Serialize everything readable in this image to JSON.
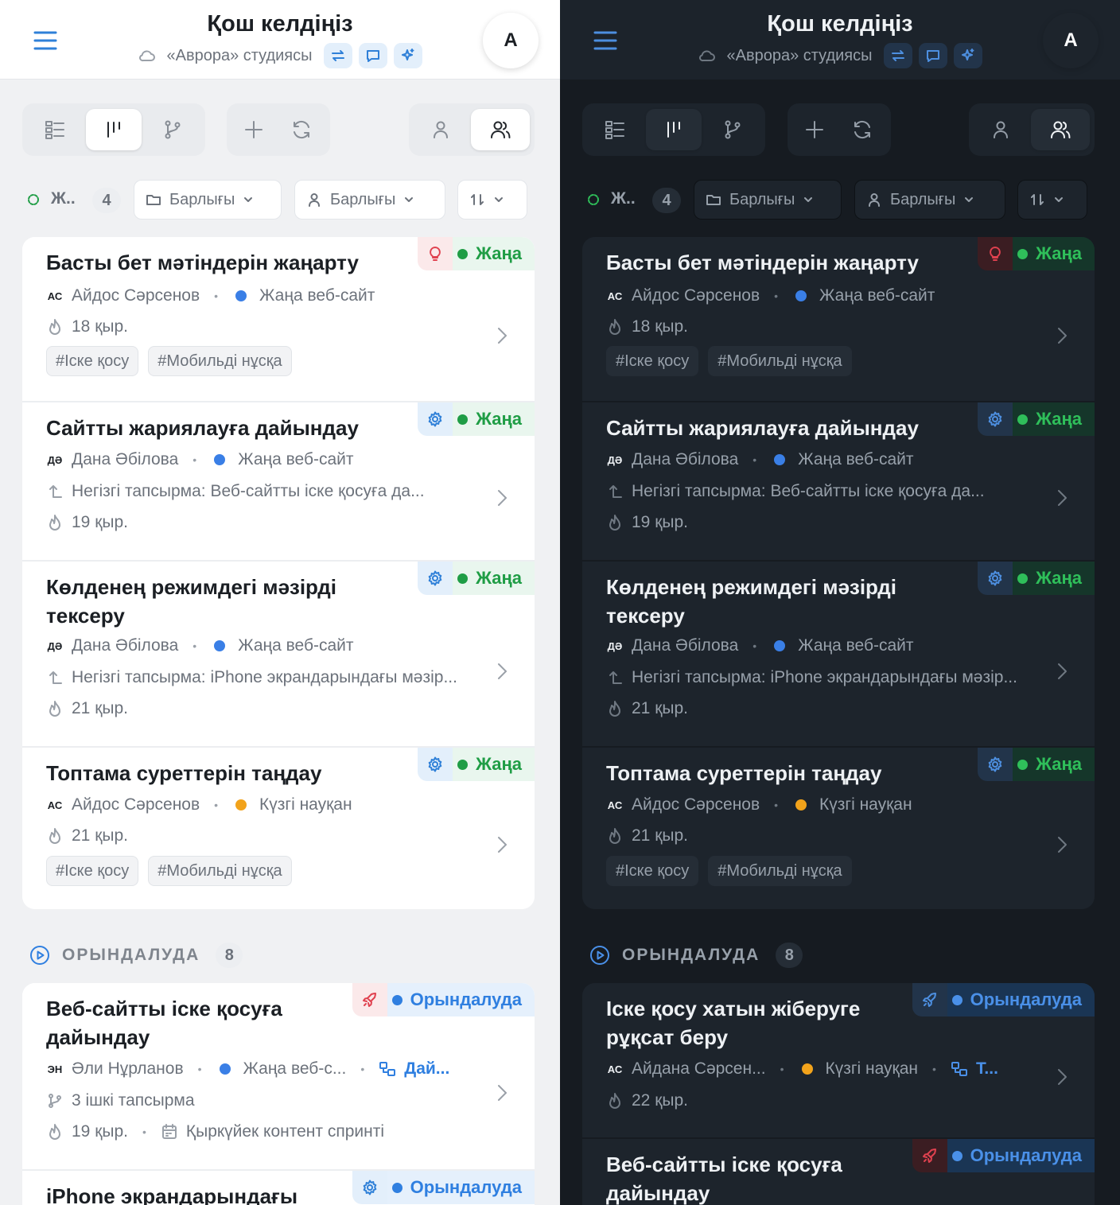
{
  "header": {
    "title": "Қош келдіңіз",
    "workspace": "«Аврора» студиясы",
    "avatar_initial": "A"
  },
  "filters": {
    "status_label": "Ж..",
    "status_count": "4",
    "project_filter": "Барлығы",
    "assignee_filter": "Барлығы"
  },
  "sections": [
    {
      "title": "ОРЫНДАЛУДА",
      "count": "8"
    }
  ],
  "light": {
    "new_tasks": [
      {
        "title": "Басты бет мәтіндерін жаңарту",
        "status": "Жаңа",
        "type_icon": "lightbulb-icon",
        "initials": "АС",
        "assignee": "Айдос Сәрсенов",
        "project": "Жаңа веб-сайт",
        "project_color": "#3a7fe6",
        "due": "18 қыр.",
        "tags": [
          "#Іске қосу",
          "#Мобильді нұсқа"
        ]
      },
      {
        "title": "Сайтты жариялауға дайындау",
        "status": "Жаңа",
        "type_icon": "gear-icon",
        "initials": "ДӘ",
        "assignee": "Дана Әбілова",
        "project": "Жаңа веб-сайт",
        "project_color": "#3a7fe6",
        "parent": "Негізгі тапсырма: Веб-сайтты іске қосуға да...",
        "due": "19 қыр."
      },
      {
        "title": "Көлденең режимдегі мәзірді тексеру",
        "status": "Жаңа",
        "type_icon": "gear-icon",
        "initials": "ДӘ",
        "assignee": "Дана Әбілова",
        "project": "Жаңа веб-сайт",
        "project_color": "#3a7fe6",
        "parent": "Негізгі тапсырма: iPhone экрандарындағы мәзір...",
        "due": "21 қыр."
      },
      {
        "title": "Топтама суреттерін таңдау",
        "status": "Жаңа",
        "type_icon": "gear-icon",
        "initials": "АС",
        "assignee": "Айдос Сәрсенов",
        "project": "Күзгі науқан",
        "project_color": "#f2a31b",
        "due": "21 қыр.",
        "tags": [
          "#Іске қосу",
          "#Мобильді нұсқа"
        ]
      }
    ],
    "in_progress": [
      {
        "title": "Веб-сайтты іске қосуға дайындау",
        "status": "Орындалуда",
        "type_icon": "rocket-icon",
        "initials": "ЭН",
        "assignee": "Әли Нұрланов",
        "project": "Жаңа веб-с...",
        "project_color": "#3a7fe6",
        "link": "Дай...",
        "subtasks": "3 ішкі тапсырма",
        "due": "19 қыр.",
        "sprint": "Қыркүйек контент спринті"
      },
      {
        "title": "iPhone экрандарындағы мәзірді",
        "status": "Орындалуда",
        "type_icon": "gear-icon"
      }
    ]
  },
  "dark": {
    "new_tasks": [
      {
        "title": "Басты бет мәтіндерін жаңарту",
        "status": "Жаңа",
        "type_icon": "lightbulb-icon",
        "initials": "АС",
        "assignee": "Айдос Сәрсенов",
        "project": "Жаңа веб-сайт",
        "project_color": "#3a7fe6",
        "due": "18 қыр.",
        "tags": [
          "#Іске қосу",
          "#Мобильді нұсқа"
        ]
      },
      {
        "title": "Сайтты жариялауға дайындау",
        "status": "Жаңа",
        "type_icon": "gear-icon",
        "initials": "ДӘ",
        "assignee": "Дана Әбілова",
        "project": "Жаңа веб-сайт",
        "project_color": "#3a7fe6",
        "parent": "Негізгі тапсырма: Веб-сайтты іске қосуға да...",
        "due": "19 қыр."
      },
      {
        "title": "Көлденең режимдегі мәзірді тексеру",
        "status": "Жаңа",
        "type_icon": "gear-icon",
        "initials": "ДӘ",
        "assignee": "Дана Әбілова",
        "project": "Жаңа веб-сайт",
        "project_color": "#3a7fe6",
        "parent": "Негізгі тапсырма: iPhone экрандарындағы мәзір...",
        "due": "21 қыр."
      },
      {
        "title": "Топтама суреттерін таңдау",
        "status": "Жаңа",
        "type_icon": "gear-icon",
        "initials": "АС",
        "assignee": "Айдос Сәрсенов",
        "project": "Күзгі науқан",
        "project_color": "#f2a31b",
        "due": "21 қыр.",
        "tags": [
          "#Іске қосу",
          "#Мобильді нұсқа"
        ]
      }
    ],
    "in_progress": [
      {
        "title": "Іске қосу хатын жіберуге рұқсат беру",
        "status": "Орындалуда",
        "type_icon": "rocket-icon",
        "initials": "АС",
        "assignee": "Айдана Сәрсен...",
        "project": "Күзгі науқан",
        "project_color": "#f2a31b",
        "link": "Т...",
        "due": "22 қыр."
      },
      {
        "title": "Веб-сайтты іске қосуға дайындау",
        "status": "Орындалуда",
        "type_icon": "rocket-icon"
      }
    ]
  },
  "colors": {
    "accent": "#2f80d8",
    "status_new": "#1f9d45",
    "status_in_progress": "#2f7fe0",
    "idea": "#e0414f"
  }
}
